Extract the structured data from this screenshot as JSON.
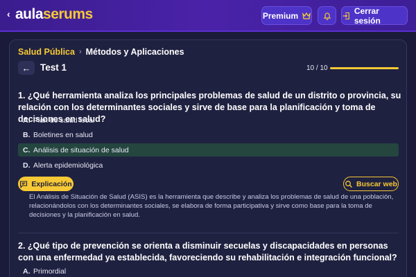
{
  "header": {
    "logo_white": "aula",
    "logo_yellow": "serums",
    "premium_label": "Premium",
    "logout_label": "Cerrar sesión"
  },
  "breadcrumb": {
    "parent": "Salud Pública",
    "current": "Métodos y Aplicaciones"
  },
  "test": {
    "title": "Test 1",
    "progress_text": "10 / 10",
    "progress_fraction": 1.0
  },
  "questions": [
    {
      "text": "1. ¿Qué herramienta analiza los principales problemas de salud de un distrito o provincia, su relación con los determinantes sociales y sirve de base para la planificación y toma de decisiones en salud?",
      "options": [
        {
          "letter": "A.",
          "text": "Plan de salud local"
        },
        {
          "letter": "B.",
          "text": "Boletines en salud"
        },
        {
          "letter": "C.",
          "text": "Análisis de situación de salud"
        },
        {
          "letter": "D.",
          "text": "Alerta epidemiológica"
        }
      ],
      "selected": "C.",
      "explanation_label": "Explicación",
      "search_label": "Buscar web",
      "explanation": "El Análisis de Situación de Salud (ASIS) es la herramienta que describe y analiza los problemas de salud de una población, relacionándolos con los determinantes sociales, se elabora de forma participativa y sirve como base para la toma de decisiones y la planificación en salud."
    },
    {
      "text": "2. ¿Qué tipo de prevención se orienta a disminuir secuelas y discapacidades en personas con una enfermedad ya establecida, favoreciendo su rehabilitación e integración funcional?",
      "options": [
        {
          "letter": "A.",
          "text": "Primordial"
        }
      ]
    }
  ],
  "colors": {
    "accent": "#f7c936",
    "header": "#4a22a8",
    "selected_option": "#24463f"
  }
}
